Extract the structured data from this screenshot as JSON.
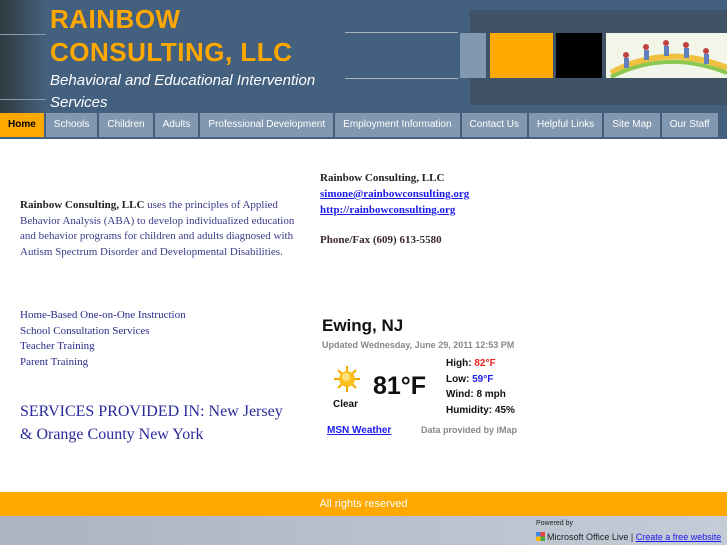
{
  "header": {
    "title_line1": "RAINBOW",
    "title_line2": "CONSULTING, LLC",
    "subtitle": "Behavioral and Educational Intervention Services",
    "colors": {
      "brand_orange": "#ffa800",
      "header_blue": "#44607f"
    }
  },
  "nav": {
    "items": [
      {
        "label": "Home",
        "active": true
      },
      {
        "label": "Schools"
      },
      {
        "label": "Children"
      },
      {
        "label": "Adults"
      },
      {
        "label": "Professional Development"
      },
      {
        "label": "Employment Information"
      },
      {
        "label": "Contact Us"
      },
      {
        "label": "Helpful Links"
      },
      {
        "label": "Site Map"
      },
      {
        "label": "Our Staff"
      }
    ]
  },
  "intro": {
    "company": "Rainbow Consulting, LLC",
    "text": " uses the principles of Applied Behavior Analysis (ABA) to develop individualized education and behavior programs for children and adults diagnosed with Autism Spectrum Disorder and Developmental Disabilities."
  },
  "contact": {
    "name": "Rainbow Consulting, LLC",
    "email": "simone@rainbowconsulting.org",
    "website": "http://rainbowconsulting.org",
    "phone": "Phone/Fax (609) 613-5580"
  },
  "services": [
    "Home-Based One-on-One Instruction",
    "School Consultation Services",
    "Teacher Training",
    "Parent Training"
  ],
  "region": "SERVICES PROVIDED IN:  New Jersey & Orange County New York",
  "weather": {
    "city": "Ewing, NJ",
    "updated": "Updated Wednesday, June 29, 2011 12:53 PM",
    "icon": "sun-icon",
    "condition": "Clear",
    "temp": "81°F",
    "high_label": "High: ",
    "high": "82°F",
    "low_label": "Low: ",
    "low": "59°F",
    "wind": "Wind: 8 mph",
    "humidity": "Humidity: 45%",
    "msn_link": "MSN Weather",
    "provider": "Data provided by iMap"
  },
  "footer": {
    "rights": "All rights reserved",
    "powered_by": "Powered by",
    "platform": "Microsoft Office Live",
    "separator": " | ",
    "create_link": "Create a free website"
  }
}
